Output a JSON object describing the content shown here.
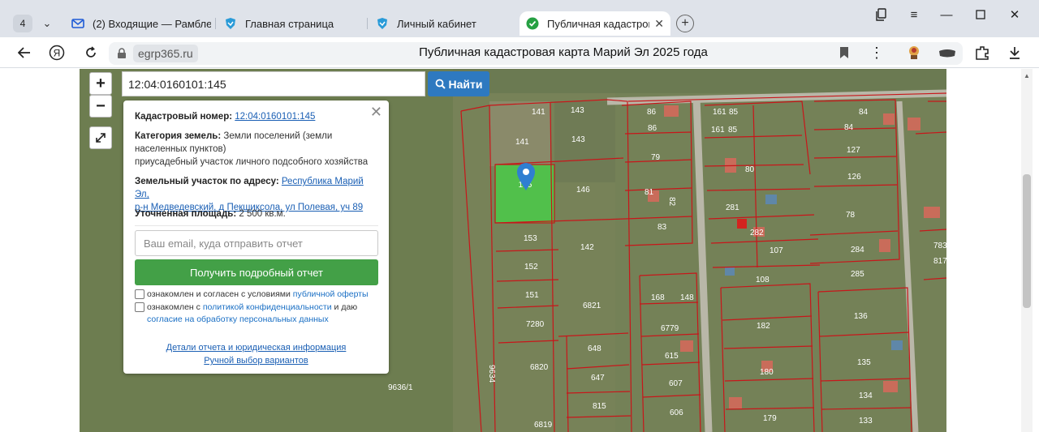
{
  "browser": {
    "tab_count": "4",
    "tabs": [
      {
        "label": "(2) Входящие — Рамблер",
        "icon": "mail-icon"
      },
      {
        "label": "Главная страница",
        "icon": "site-shield-icon"
      },
      {
        "label": "Личный кабинет",
        "icon": "site-shield-icon"
      },
      {
        "label": "Публичная кадастрова",
        "icon": "check-circle-icon",
        "active": true
      }
    ],
    "new_tab_label": "+",
    "address": {
      "domain": "egrp365.ru",
      "page_title": "Публичная кадастровая карта Марий Эл 2025 года"
    }
  },
  "map": {
    "zoom_in": "+",
    "zoom_out": "−",
    "search": {
      "value": "12:04:0160101:145",
      "button_label": "Найти"
    },
    "selected_parcel_label": "145",
    "parcel_labels": [
      "141",
      "143",
      "141",
      "143",
      "146",
      "153",
      "142",
      "152",
      "151",
      "6821",
      "7280",
      "648",
      "6820",
      "647",
      "815",
      "6819",
      "9636/1",
      "9634",
      "86",
      "86",
      "79",
      "81",
      "82",
      "83",
      "161",
      "85",
      "161",
      "85",
      "80",
      "281",
      "282",
      "107",
      "108",
      "127",
      "84",
      "84",
      "126",
      "78",
      "284",
      "285",
      "168",
      "148",
      "6779",
      "615",
      "607",
      "606",
      "182",
      "180",
      "179",
      "136",
      "135",
      "134",
      "133",
      "783",
      "817"
    ]
  },
  "popup": {
    "cadastral_label": "Кадастровый номер:",
    "cadastral_value": "12:04:0160101:145",
    "category_label": "Категория земель:",
    "category_line1": "Земли поселений (земли",
    "category_line2": "населенных пунктов)",
    "category_line3": "приусадебный участок личного подсобного хозяйства",
    "address_label": "Земельный участок по адресу:",
    "address_line1": "Республика Марий Эл,",
    "address_line2": "р-н Медведевский, д Пекшиксола, ул Полевая, уч 89",
    "area_label": "Уточненная площадь:",
    "area_value": "2 500 кв.м.",
    "email_placeholder": "Ваш email, куда отправить отчет",
    "get_report_button": "Получить подробный отчет",
    "consent1_text": "ознакомлен и согласен с условиями",
    "consent1_link": "публичной оферты",
    "consent2_text": "ознакомлен с",
    "consent2_link": "политикой конфиденциальности",
    "consent2_mid": "и даю",
    "consent2_link2": "согласие на обработку персональных данных",
    "details_link": "Детали отчета и юридическая информация",
    "manual_link": "Ручной выбор вариантов"
  }
}
